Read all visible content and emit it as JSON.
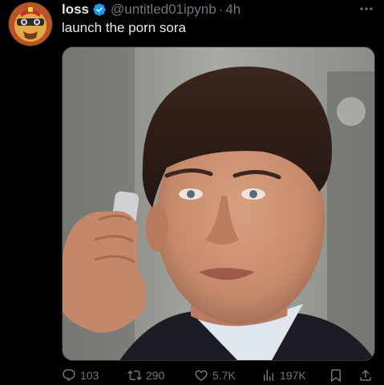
{
  "tweet": {
    "display_name": "loss",
    "handle": "@untitled01ipynb",
    "separator": "·",
    "time": "4h",
    "text": "launch the porn sora",
    "verified_color": "#1d9bf0"
  },
  "actions": {
    "replies": "103",
    "retweets": "290",
    "likes": "5.7K",
    "views": "197K"
  },
  "icons": {
    "verified": "verified-badge-icon",
    "more": "more-horizontal-icon",
    "reply": "reply-icon",
    "retweet": "retweet-icon",
    "like": "heart-icon",
    "views": "views-chart-icon",
    "bookmark": "bookmark-icon",
    "share": "share-icon"
  },
  "colors": {
    "background": "#000000",
    "primary_text": "#e7e9ea",
    "secondary_text": "#71767b",
    "border": "#2f3336"
  }
}
